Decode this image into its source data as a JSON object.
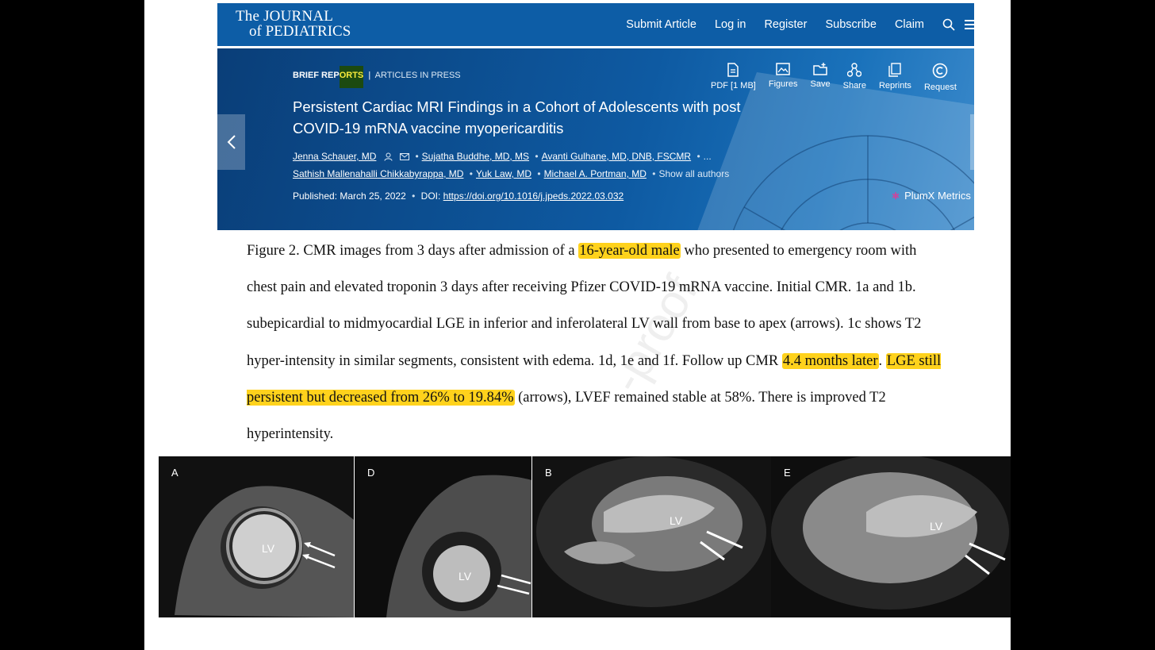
{
  "topbar": {
    "logo_line1": "The JOURNAL",
    "logo_line2": "of PEDIATRICS",
    "nav": [
      "Submit Article",
      "Log in",
      "Register",
      "Subscribe",
      "Claim"
    ]
  },
  "article": {
    "breadcrumb_section_a": "BRIEF REP",
    "breadcrumb_section_b": "ORTS",
    "breadcrumb_link": "ARTICLES IN PRESS",
    "title": "Persistent Cardiac MRI Findings in a Cohort of Adolescents with post COVID-19 mRNA vaccine myopericarditis",
    "authors_line1": [
      "Jenna Schauer, MD",
      "Sujatha Buddhe, MD, MS",
      "Avanti Gulhane, MD, DNB, FSCMR"
    ],
    "authors_more": "...",
    "authors_line2": [
      "Sathish Mallenahalli Chikkabyrappa, MD",
      "Yuk Law, MD",
      "Michael A. Portman, MD"
    ],
    "show_all": "Show all authors",
    "published": "Published: March 25, 2022",
    "doi_label": "DOI:",
    "doi_link": "https://doi.org/10.1016/j.jpeds.2022.03.032",
    "tools": [
      {
        "label": "PDF [1 MB]",
        "icon": "pdf-icon"
      },
      {
        "label": "Figures",
        "icon": "figures-icon"
      },
      {
        "label": "Save",
        "icon": "save-icon"
      },
      {
        "label": "Share",
        "icon": "share-icon"
      },
      {
        "label": "Reprints",
        "icon": "reprints-icon"
      },
      {
        "label": "Request",
        "icon": "request-icon"
      }
    ],
    "plumx": "PlumX Metrics"
  },
  "caption": {
    "p1": "Figure 2. CMR images from 3 days after admission of a ",
    "h1": "16-year-old male",
    "p2": " who presented to emergency room with chest pain and elevated troponin 3 days after receiving Pfizer COVID-19 mRNA vaccine. Initial CMR. 1a and 1b. subepicardial to midmyocardial LGE in inferior and inferolateral LV wall from base to apex (arrows). 1c shows T2 hyper-intensity in similar segments, consistent with edema. 1d, 1e and 1f. Follow up CMR ",
    "h2": "4.4 months later",
    "p3": ". ",
    "h3": "LGE still persistent but decreased from 26% to 19.84%",
    "p4": " (arrows), LVEF remained stable at 58%. There is improved T2 hyperintensity.",
    "watermark": "-proof"
  },
  "mri_panels": [
    {
      "label": "A",
      "lv": "LV"
    },
    {
      "label": "D",
      "lv": "LV"
    },
    {
      "label": "B",
      "lv": "LV"
    },
    {
      "label": "E",
      "lv": "LV"
    }
  ],
  "colors": {
    "journal_blue": "#0d5da6",
    "highlight": "#ffd21c"
  }
}
